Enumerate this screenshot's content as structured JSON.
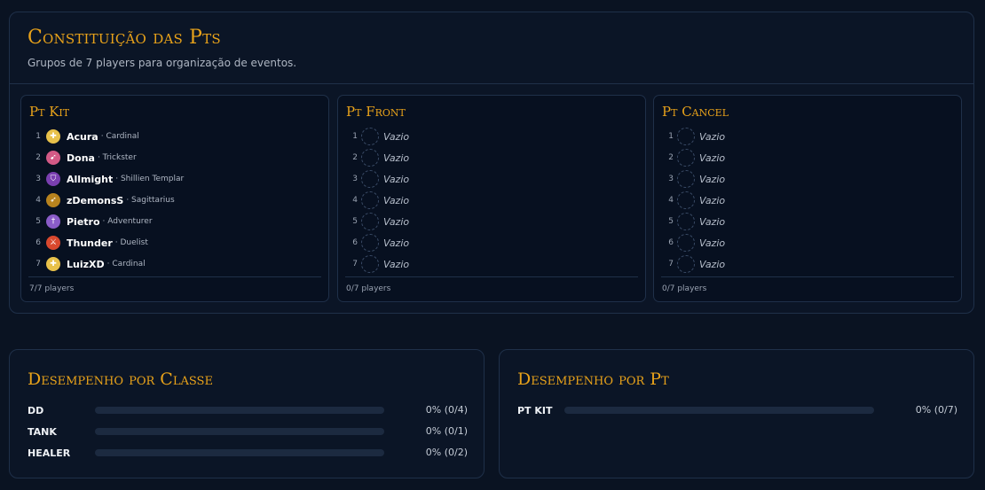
{
  "parties_section": {
    "title": "Constituição das Pts",
    "subtitle": "Grupos de 7 players para organização de eventos."
  },
  "parties": [
    {
      "name": "Pt Kit",
      "count_label": "7/7 players",
      "slots": [
        {
          "num": "1",
          "player": "Acura",
          "class": "· Cardinal",
          "icon": "cross-icon",
          "color": "#e8c14a"
        },
        {
          "num": "2",
          "player": "Dona",
          "class": "· Trickster",
          "icon": "arrow-icon",
          "color": "#d35a86"
        },
        {
          "num": "3",
          "player": "Allmight",
          "class": "· Shillien Templar",
          "icon": "shield-icon",
          "color": "#7a3fb0"
        },
        {
          "num": "4",
          "player": "zDemonsS",
          "class": "· Sagittarius",
          "icon": "bow-icon",
          "color": "#b8831e"
        },
        {
          "num": "5",
          "player": "Pietro",
          "class": "· Adventurer",
          "icon": "dagger-icon",
          "color": "#8a5cc8"
        },
        {
          "num": "6",
          "player": "Thunder",
          "class": "· Duelist",
          "icon": "swords-icon",
          "color": "#d9482e"
        },
        {
          "num": "7",
          "player": "LuizXD",
          "class": "· Cardinal",
          "icon": "cross-icon",
          "color": "#e8c14a"
        }
      ]
    },
    {
      "name": "Pt Front",
      "count_label": "0/7 players",
      "slots": [
        {
          "num": "1",
          "empty": "Vazio"
        },
        {
          "num": "2",
          "empty": "Vazio"
        },
        {
          "num": "3",
          "empty": "Vazio"
        },
        {
          "num": "4",
          "empty": "Vazio"
        },
        {
          "num": "5",
          "empty": "Vazio"
        },
        {
          "num": "6",
          "empty": "Vazio"
        },
        {
          "num": "7",
          "empty": "Vazio"
        }
      ]
    },
    {
      "name": "Pt Cancel",
      "count_label": "0/7 players",
      "slots": [
        {
          "num": "1",
          "empty": "Vazio"
        },
        {
          "num": "2",
          "empty": "Vazio"
        },
        {
          "num": "3",
          "empty": "Vazio"
        },
        {
          "num": "4",
          "empty": "Vazio"
        },
        {
          "num": "5",
          "empty": "Vazio"
        },
        {
          "num": "6",
          "empty": "Vazio"
        },
        {
          "num": "7",
          "empty": "Vazio"
        }
      ]
    }
  ],
  "class_performance": {
    "title": "Desempenho por Classe",
    "rows": [
      {
        "label": "DD",
        "value_text": "0% (0/4)",
        "progress": 0
      },
      {
        "label": "TANK",
        "value_text": "0% (0/1)",
        "progress": 0
      },
      {
        "label": "HEALER",
        "value_text": "0% (0/2)",
        "progress": 0
      }
    ]
  },
  "party_performance": {
    "title": "Desempenho por Pt",
    "rows": [
      {
        "label": "PT KIT",
        "value_text": "0% (0/7)",
        "progress": 0
      }
    ]
  },
  "colors": {
    "accent": "#e8a21a",
    "background": "#0a1322",
    "panel": "#0b1526",
    "border": "#1f3049"
  }
}
